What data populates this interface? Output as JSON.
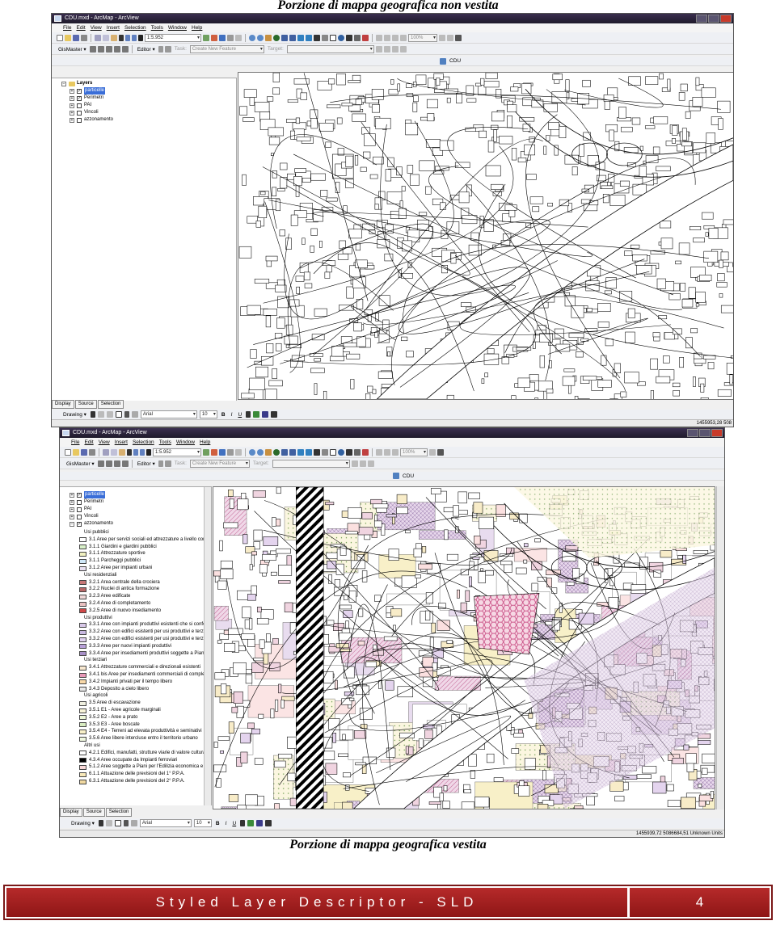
{
  "captions": {
    "top": "Porzione di mappa geografica non vestita",
    "bottom": "Porzione di mappa geografica vestita"
  },
  "window1": {
    "title": "CDU.mxd - ArcMap - ArcView",
    "menu": [
      "File",
      "Edit",
      "View",
      "Insert",
      "Selection",
      "Tools",
      "Window",
      "Help"
    ],
    "scale": "1:5.952",
    "zoom": "100%",
    "gismaster": "GisMaster ▾",
    "editor": "Editor ▾",
    "task_label": "Task:",
    "task_value": "Create New Feature",
    "target_label": "Target:",
    "cdu_tab": "CDU",
    "layers": {
      "root": "Layers",
      "items": [
        {
          "label": "particelle",
          "checked": true,
          "selected": true
        },
        {
          "label": "Perimetri",
          "checked": true,
          "selected": false
        },
        {
          "label": "PAI",
          "checked": false,
          "selected": false
        },
        {
          "label": "Vincoli",
          "checked": false,
          "selected": false
        },
        {
          "label": "azzonamento",
          "checked": false,
          "selected": false
        }
      ]
    },
    "tabs": [
      "Display",
      "Source",
      "Selection"
    ],
    "drawing": "Drawing ▾",
    "font": "Arial",
    "font_size": "10",
    "coords": "1455953,28  508"
  },
  "window2": {
    "title": "CDU.mxd - ArcMap - ArcView",
    "menu": [
      "File",
      "Edit",
      "View",
      "Insert",
      "Selection",
      "Tools",
      "Window",
      "Help"
    ],
    "scale": "1:5.952",
    "zoom": "100%",
    "gismaster": "GisMaster ▾",
    "editor": "Editor ▾",
    "task_label": "Task:",
    "task_value": "Create New Feature",
    "target_label": "Target:",
    "cdu_tab": "CDU",
    "layers": {
      "items": [
        {
          "label": "particelle",
          "checked": true,
          "selected": true
        },
        {
          "label": "Perimetri",
          "checked": false,
          "selected": false
        },
        {
          "label": "PAI",
          "checked": false,
          "selected": false
        },
        {
          "label": "Vincoli",
          "checked": false,
          "selected": false
        },
        {
          "label": "azzonamento",
          "checked": true,
          "selected": false
        }
      ]
    },
    "legend": [
      {
        "label": "Usi pubblici",
        "header": true
      },
      {
        "label": "3.1 Aree per servizi sociali ed attrezzature a livello comunale",
        "color": "#ffffff"
      },
      {
        "label": "3.1.1 Giardini e giardini pubblici",
        "color": "#d8f0c8"
      },
      {
        "label": "3.1.1 Attrezzature sportive",
        "color": "#f0f0c0"
      },
      {
        "label": "3.1.1 Parcheggi pubblici",
        "color": "#d0e8f8"
      },
      {
        "label": "3.1.2 Aree per impianti urbani",
        "color": "#e8e0f0"
      },
      {
        "label": "Usi residenziali",
        "header": true
      },
      {
        "label": "3.2.1 Area centrale della crociera",
        "color": "#c87878"
      },
      {
        "label": "3.2.2 Nuclei di antica formazione",
        "color": "#b86868"
      },
      {
        "label": "3.2.3 Aree edificate",
        "color": "#f0d8d8"
      },
      {
        "label": "3.2.4 Aree di completamento",
        "color": "#e8c0c0"
      },
      {
        "label": "3.2.5 Aree di nuovo insediamento",
        "color": "#d04848"
      },
      {
        "label": "Usi produttivi",
        "header": true
      },
      {
        "label": "3.3.1 Aree con impianti produttivi esistenti che si confermano",
        "color": "#d8c8e8"
      },
      {
        "label": "3.3.2 Aree con edifici esistenti per usi produttivi e terziari",
        "color": "#c8b8e0"
      },
      {
        "label": "3.3.2 Aree con edifici esistenti per usi produttivi e terziari",
        "color": "#e0d0f0"
      },
      {
        "label": "3.3.3 Aree per nuovi impianti produttivi",
        "color": "#b8a0d8"
      },
      {
        "label": "3.3.4 Aree per insediamenti produttivi soggette a Piano Particola",
        "color": "#a890c8"
      },
      {
        "label": "Usi terziari",
        "header": true
      },
      {
        "label": "3.4.1 Attrezzature commerciali e direzionali esistenti",
        "color": "#f8e8d0"
      },
      {
        "label": "3.4.1 bis Aree per insediamenti commerciali di completamento",
        "color": "#e898b8"
      },
      {
        "label": "3.4.2 Impianti privati per il tempo libero",
        "color": "#f8d8a8"
      },
      {
        "label": "3.4.3 Deposito a cielo libero",
        "color": "#e8e8e8"
      },
      {
        "label": "Usi agricoli",
        "header": true
      },
      {
        "label": "3.5 Aree di escavazione",
        "color": "#f0f0e0"
      },
      {
        "label": "3.5.1 E1 - Aree agricole marginali",
        "color": "#f8f4d8"
      },
      {
        "label": "3.5.2 E2 - Aree a prato",
        "color": "#eef8d8"
      },
      {
        "label": "3.5.3 E3 - Aree boscate",
        "color": "#d8ecc0"
      },
      {
        "label": "3.5.4 E4 - Terreni ad elevata produttività e seminativi",
        "color": "#f8f0c8"
      },
      {
        "label": "3.5.6 Aree libere intercluse entro il territorio urbano",
        "color": "#f0f8e0"
      },
      {
        "label": "Altri usi",
        "header": true
      },
      {
        "label": "4.2.1 Edifici, manufatti, strutture viarie di valore culturale e ambi",
        "color": "#ffffff"
      },
      {
        "label": "4.3.4 Aree occupate da Impianti ferroviari",
        "color": "#000000"
      },
      {
        "label": "5.1.2 Aree soggette a Piani per l'Edilizia economica e Popolare",
        "color": "#f8d8d8"
      },
      {
        "label": "6.1.1 Attuazione delle previsioni del 1° P.P.A.",
        "color": "#f8e8b8"
      },
      {
        "label": "6.3.1 Attuazione delle previsioni del 2° P.P.A.",
        "color": "#f0d8a0"
      }
    ],
    "tabs": [
      "Display",
      "Source",
      "Selection"
    ],
    "drawing": "Drawing ▾",
    "font": "Arial",
    "font_size": "10",
    "coords": "1455939,72  5086684,51 Unknown Units"
  },
  "footer": {
    "title": "Styled Layer Descriptor - SLD",
    "page": "4"
  },
  "colors": {
    "footer_bg": "#a01e1e",
    "selection_blue": "#3a6ed8",
    "map_pink": "#e8a8c8",
    "map_lilac": "#d8c8e8",
    "map_yellow": "#f8f0c8"
  }
}
